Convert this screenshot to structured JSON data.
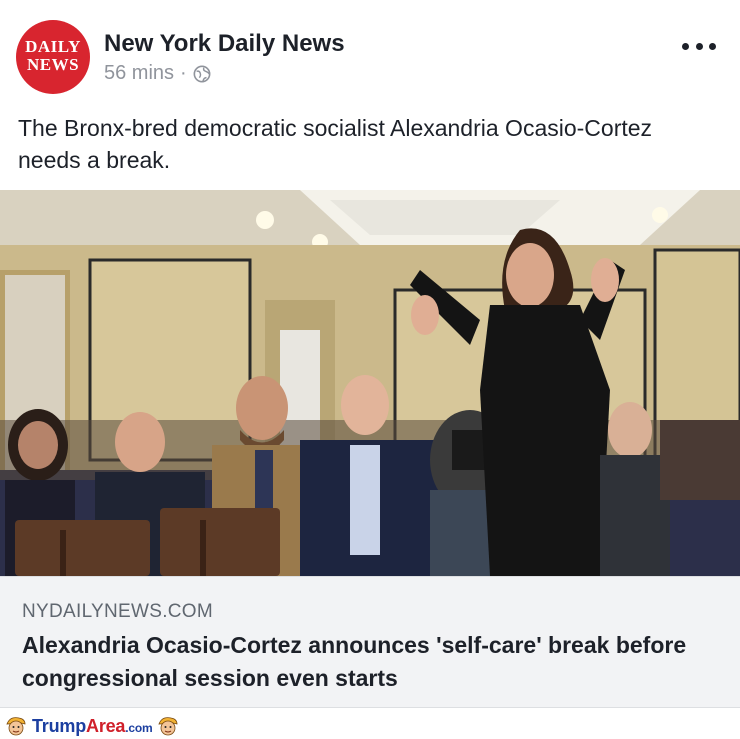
{
  "post": {
    "page_name": "New York Daily News",
    "time": "56 mins",
    "separator": "·",
    "privacy_icon": "globe-icon",
    "more_icon": "more-options-icon",
    "avatar": {
      "line1": "DAILY",
      "line2": "NEWS",
      "sub": ""
    },
    "text": "The Bronx-bred democratic socialist Alexandria Ocasio-Cortez needs a break."
  },
  "link": {
    "domain": "NYDAILYNEWS.COM",
    "title": "Alexandria Ocasio-Cortez announces 'self-care' break before congressional session even starts"
  },
  "watermark": {
    "part1": "Trump",
    "part2": "Area",
    "part3": ".com"
  },
  "colors": {
    "brand_red": "#d8252f",
    "text": "#1d2129",
    "meta": "#90949c",
    "link_bg": "#f2f3f5",
    "watermark_blue": "#1c3fa0",
    "watermark_red": "#d0202a"
  }
}
